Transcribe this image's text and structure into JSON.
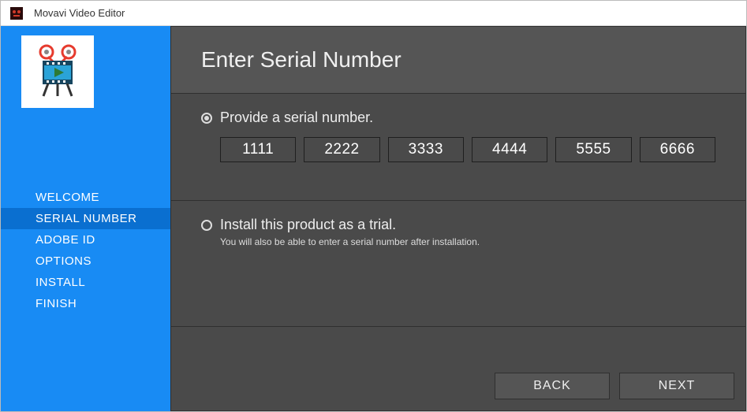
{
  "titlebar": {
    "app_name": "Movavi Video Editor"
  },
  "sidebar": {
    "items": [
      {
        "label": "WELCOME"
      },
      {
        "label": "SERIAL NUMBER"
      },
      {
        "label": "ADOBE ID"
      },
      {
        "label": "OPTIONS"
      },
      {
        "label": "INSTALL"
      },
      {
        "label": "FINISH"
      }
    ],
    "active_index": 1
  },
  "main": {
    "heading": "Enter Serial Number",
    "option_serial": {
      "label": "Provide a serial number.",
      "fields": [
        "1111",
        "2222",
        "3333",
        "4444",
        "5555",
        "6666"
      ]
    },
    "option_trial": {
      "label": "Install this product as a trial.",
      "note": "You will also be able to enter a serial number after installation."
    }
  },
  "footer": {
    "back": "BACK",
    "next": "NEXT"
  }
}
